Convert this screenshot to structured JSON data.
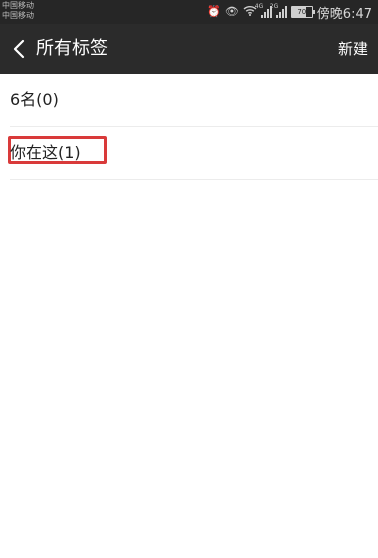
{
  "status_bar": {
    "carrier_1": "中国移动",
    "carrier_2": "中国移动",
    "network_1": "4G",
    "network_2": "2G",
    "battery": "70",
    "time": "傍晚6:47"
  },
  "header": {
    "title": "所有标签",
    "action_label": "新建"
  },
  "tags": [
    {
      "label": "6名(0)"
    },
    {
      "label": "你在这(1)",
      "highlighted": true
    }
  ],
  "colors": {
    "header_bg": "#2b2b2b",
    "status_bg": "#262626",
    "highlight": "#d93a3a"
  }
}
